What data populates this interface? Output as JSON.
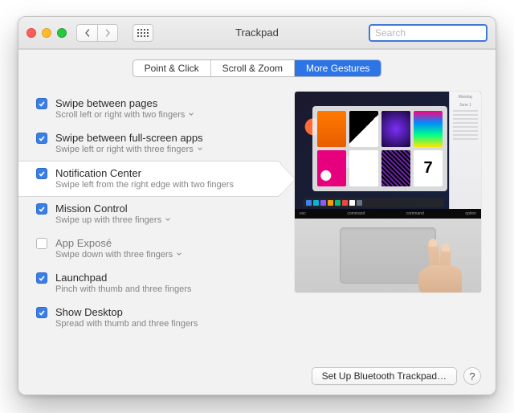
{
  "window": {
    "title": "Trackpad",
    "search_placeholder": "Search"
  },
  "tabs": [
    {
      "label": "Point & Click",
      "active": false
    },
    {
      "label": "Scroll & Zoom",
      "active": false
    },
    {
      "label": "More Gestures",
      "active": true
    }
  ],
  "options": {
    "swipe_pages": {
      "title": "Swipe between pages",
      "sub": "Scroll left or right with two fingers",
      "checked": true,
      "has_menu": true
    },
    "swipe_apps": {
      "title": "Swipe between full-screen apps",
      "sub": "Swipe left or right with three fingers",
      "checked": true,
      "has_menu": true
    },
    "notification_center": {
      "title": "Notification Center",
      "sub": "Swipe left from the right edge with two fingers",
      "checked": true,
      "has_menu": false,
      "selected": true
    },
    "mission_control": {
      "title": "Mission Control",
      "sub": "Swipe up with three fingers",
      "checked": true,
      "has_menu": true
    },
    "app_expose": {
      "title": "App Exposé",
      "sub": "Swipe down with three fingers",
      "checked": false,
      "has_menu": true
    },
    "launchpad": {
      "title": "Launchpad",
      "sub": "Pinch with thumb and three fingers",
      "checked": true,
      "has_menu": false
    },
    "show_desktop": {
      "title": "Show Desktop",
      "sub": "Spread with thumb and three fingers",
      "checked": true,
      "has_menu": false
    }
  },
  "preview": {
    "nc_day": "Monday",
    "nc_date": "June 1",
    "touchbar_left": "esc",
    "touchbar_keys": [
      "command",
      "command",
      "",
      "",
      "option"
    ]
  },
  "footer": {
    "bt_button": "Set Up Bluetooth Trackpad…",
    "help": "?"
  }
}
